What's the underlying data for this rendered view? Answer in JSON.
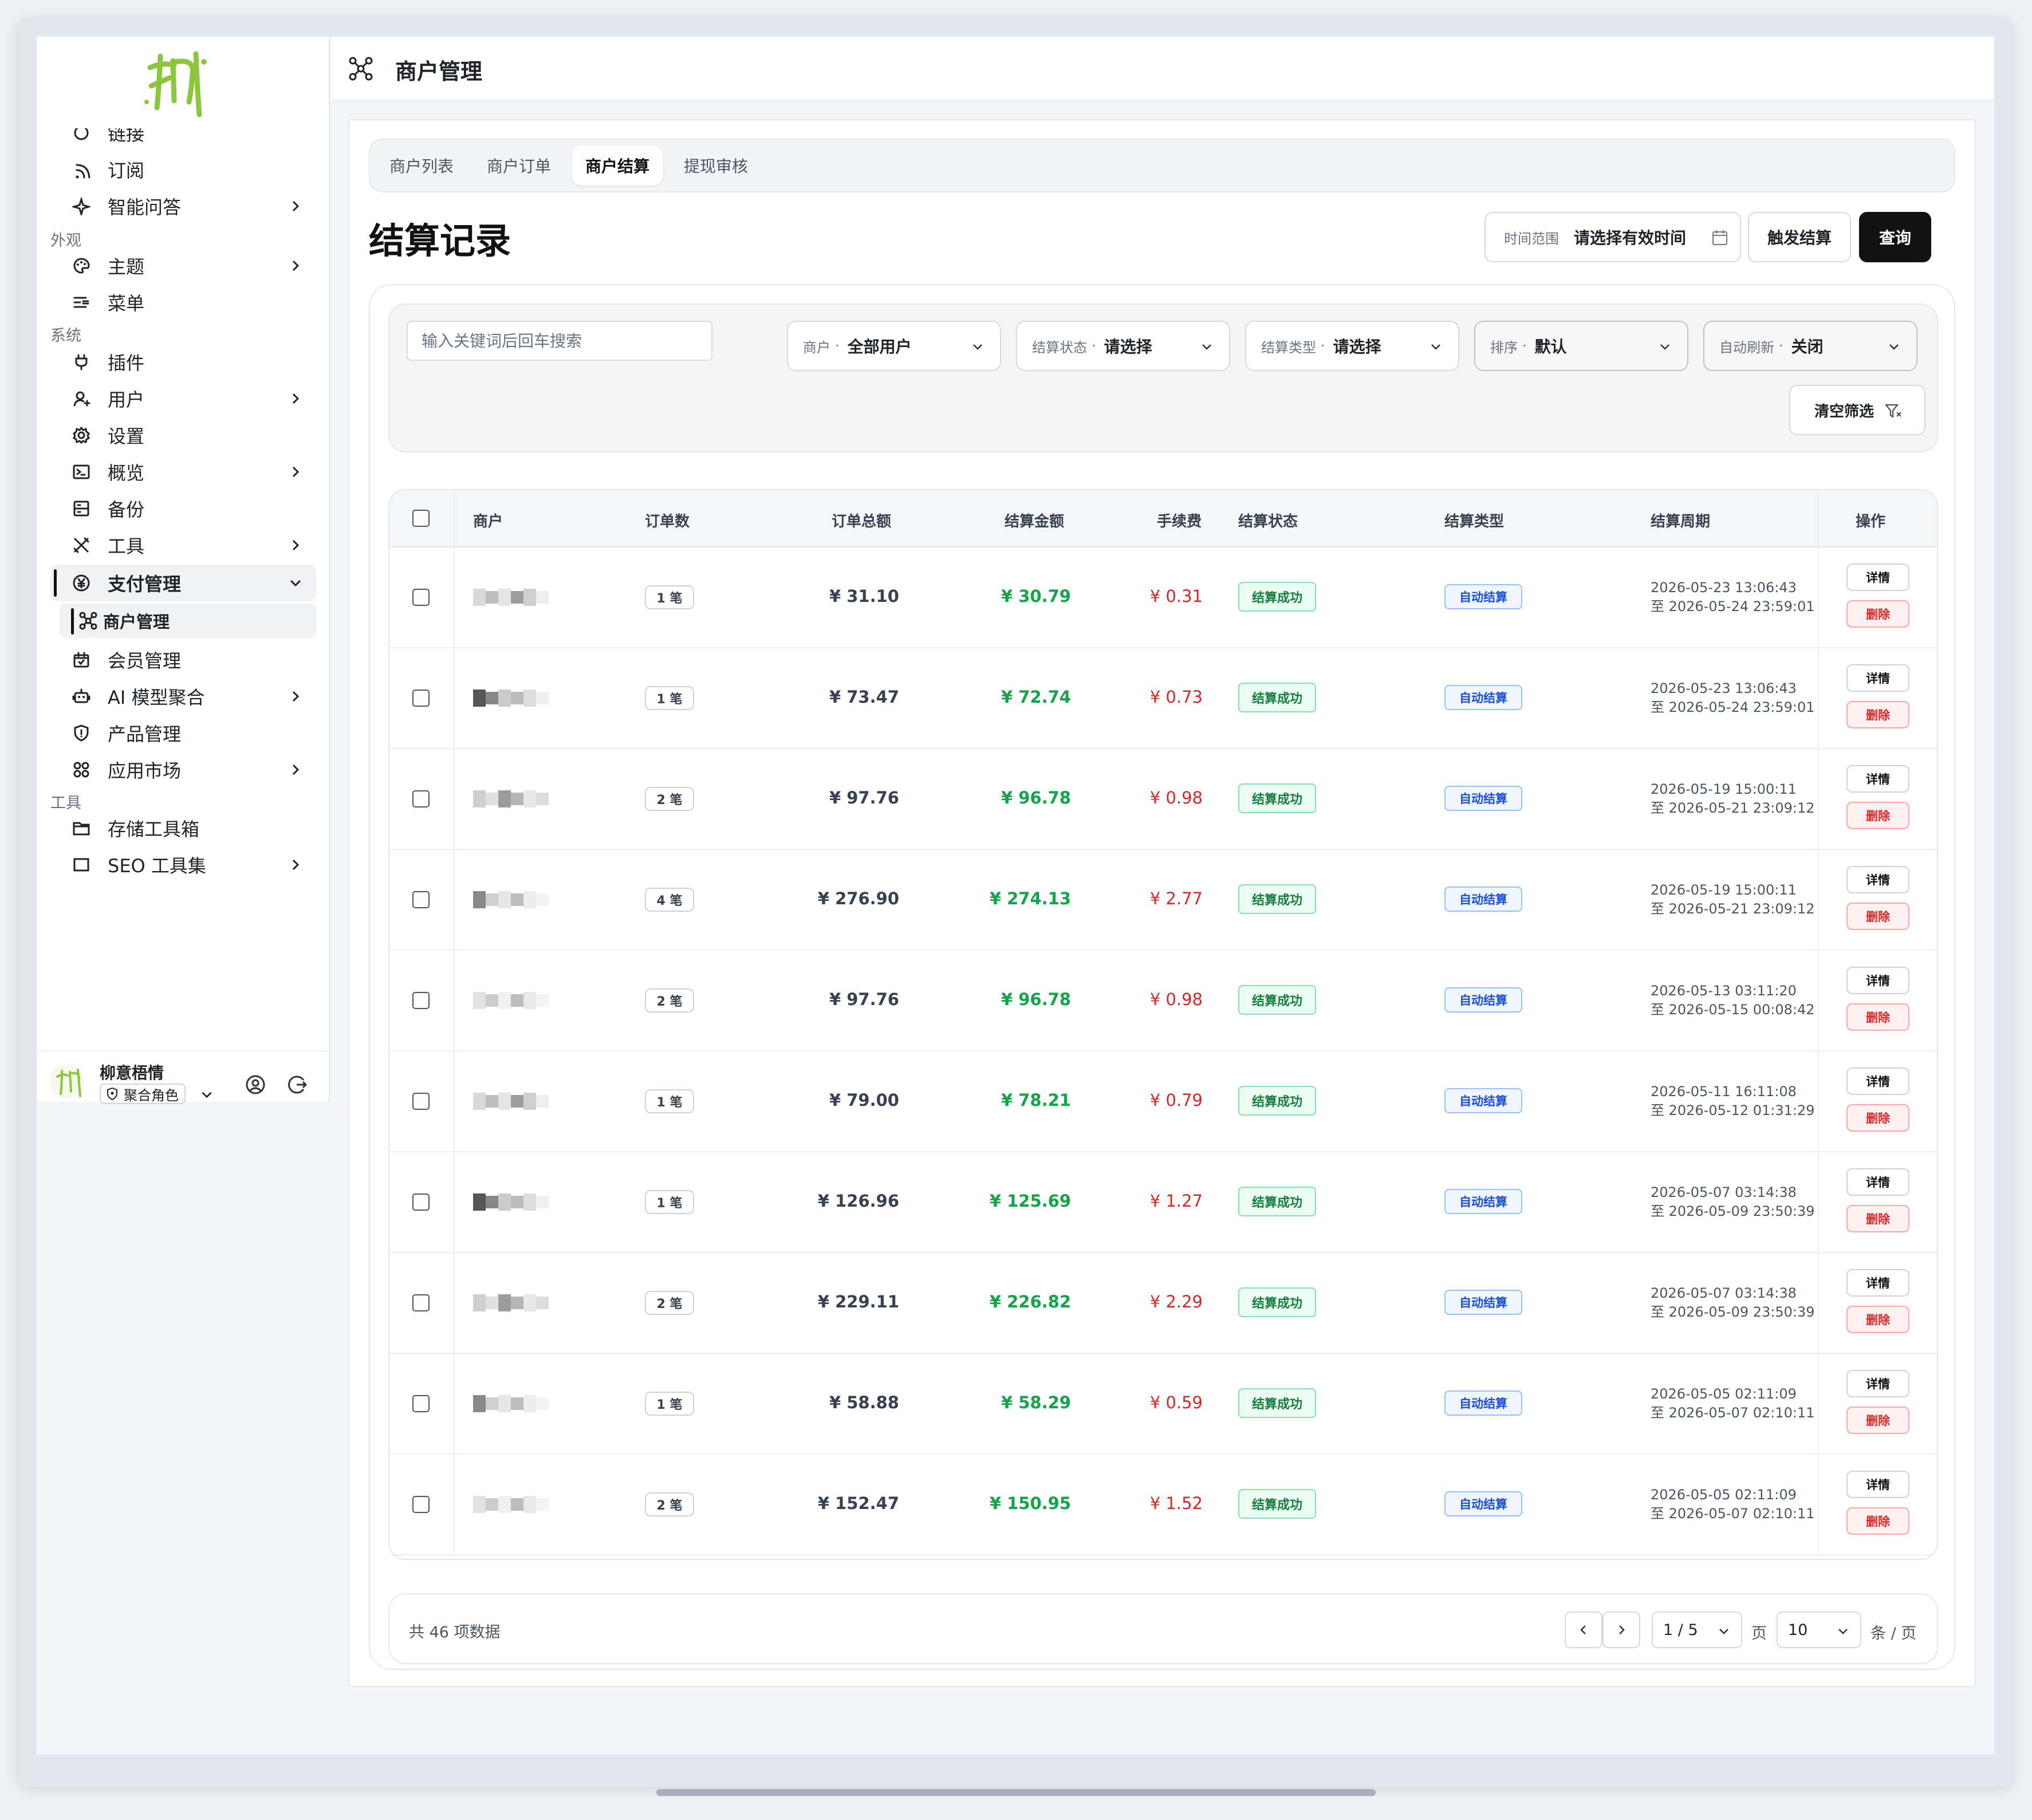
{
  "app": {
    "header_title": "商户管理",
    "user_name": "柳意梧情",
    "user_role": "聚合角色",
    "brand_color": "#8cc63f"
  },
  "sidebar": {
    "partial_top_label": "链接",
    "items": [
      {
        "label": "订阅",
        "icon": "rss-icon",
        "has_chevron": false
      },
      {
        "label": "智能问答",
        "icon": "sparkle-icon",
        "has_chevron": true
      },
      {
        "group": "外观"
      },
      {
        "label": "主题",
        "icon": "palette-icon",
        "has_chevron": true
      },
      {
        "label": "菜单",
        "icon": "menu-list-icon",
        "has_chevron": false
      },
      {
        "group": "系统"
      },
      {
        "label": "插件",
        "icon": "plug-icon",
        "has_chevron": false
      },
      {
        "label": "用户",
        "icon": "user-icon",
        "has_chevron": true
      },
      {
        "label": "设置",
        "icon": "gear-icon",
        "has_chevron": false
      },
      {
        "label": "概览",
        "icon": "terminal-icon",
        "has_chevron": true
      },
      {
        "label": "备份",
        "icon": "backup-icon",
        "has_chevron": false
      },
      {
        "label": "工具",
        "icon": "tools-icon",
        "has_chevron": true
      },
      {
        "label": "支付管理",
        "icon": "yen-circle-icon",
        "has_chevron": true,
        "expanded": true
      },
      {
        "label": "商户管理",
        "icon": "merchant-network-icon",
        "sub": true
      },
      {
        "label": "会员管理",
        "icon": "member-card-icon",
        "has_chevron": false
      },
      {
        "label": "AI 模型聚合",
        "icon": "robot-icon",
        "has_chevron": true
      },
      {
        "label": "产品管理",
        "icon": "shield-icon",
        "has_chevron": false
      },
      {
        "label": "应用市场",
        "icon": "apps-grid-icon",
        "has_chevron": true
      },
      {
        "group": "工具"
      },
      {
        "label": "存储工具箱",
        "icon": "folder-icon",
        "has_chevron": false
      }
    ],
    "partial_bottom_label": "SEO 工具集"
  },
  "tabs": [
    {
      "label": "商户列表",
      "active": false
    },
    {
      "label": "商户订单",
      "active": false
    },
    {
      "label": "商户结算",
      "active": true
    },
    {
      "label": "提现审核",
      "active": false
    }
  ],
  "page": {
    "title": "结算记录",
    "time_range_label": "时间范围",
    "time_range_value": "请选择有效时间",
    "trigger_button": "触发结算",
    "query_button": "查询"
  },
  "filters": {
    "search_placeholder": "输入关键词后回车搜索",
    "selects": [
      {
        "label": "商户",
        "value": "全部用户"
      },
      {
        "label": "结算状态",
        "value": "请选择"
      },
      {
        "label": "结算类型",
        "value": "请选择"
      },
      {
        "label": "排序",
        "value": "默认"
      },
      {
        "label": "自动刷新",
        "value": "关闭"
      }
    ],
    "clear_button": "清空筛选"
  },
  "table": {
    "columns": [
      "商户",
      "订单数",
      "订单总额",
      "结算金额",
      "手续费",
      "结算状态",
      "结算类型",
      "结算周期",
      "操作"
    ],
    "detail_label": "详情",
    "delete_label": "删除",
    "rows": [
      {
        "orders": "1 笔",
        "total": "¥ 31.10",
        "settle": "¥ 30.79",
        "fee": "¥ 0.31",
        "status": "结算成功",
        "type": "自动结算",
        "start": "2026-05-23 13:06:43",
        "end": "至 2026-05-24 23:59:01"
      },
      {
        "orders": "1 笔",
        "total": "¥ 73.47",
        "settle": "¥ 72.74",
        "fee": "¥ 0.73",
        "status": "结算成功",
        "type": "自动结算",
        "start": "2026-05-23 13:06:43",
        "end": "至 2026-05-24 23:59:01"
      },
      {
        "orders": "2 笔",
        "total": "¥ 97.76",
        "settle": "¥ 96.78",
        "fee": "¥ 0.98",
        "status": "结算成功",
        "type": "自动结算",
        "start": "2026-05-19 15:00:11",
        "end": "至 2026-05-21 23:09:12"
      },
      {
        "orders": "4 笔",
        "total": "¥ 276.90",
        "settle": "¥ 274.13",
        "fee": "¥ 2.77",
        "status": "结算成功",
        "type": "自动结算",
        "start": "2026-05-19 15:00:11",
        "end": "至 2026-05-21 23:09:12"
      },
      {
        "orders": "2 笔",
        "total": "¥ 97.76",
        "settle": "¥ 96.78",
        "fee": "¥ 0.98",
        "status": "结算成功",
        "type": "自动结算",
        "start": "2026-05-13 03:11:20",
        "end": "至 2026-05-15 00:08:42"
      },
      {
        "orders": "1 笔",
        "total": "¥ 79.00",
        "settle": "¥ 78.21",
        "fee": "¥ 0.79",
        "status": "结算成功",
        "type": "自动结算",
        "start": "2026-05-11 16:11:08",
        "end": "至 2026-05-12 01:31:29"
      },
      {
        "orders": "1 笔",
        "total": "¥ 126.96",
        "settle": "¥ 125.69",
        "fee": "¥ 1.27",
        "status": "结算成功",
        "type": "自动结算",
        "start": "2026-05-07 03:14:38",
        "end": "至 2026-05-09 23:50:39"
      },
      {
        "orders": "2 笔",
        "total": "¥ 229.11",
        "settle": "¥ 226.82",
        "fee": "¥ 2.29",
        "status": "结算成功",
        "type": "自动结算",
        "start": "2026-05-07 03:14:38",
        "end": "至 2026-05-09 23:50:39"
      },
      {
        "orders": "1 笔",
        "total": "¥ 58.88",
        "settle": "¥ 58.29",
        "fee": "¥ 0.59",
        "status": "结算成功",
        "type": "自动结算",
        "start": "2026-05-05 02:11:09",
        "end": "至 2026-05-07 02:10:11"
      },
      {
        "orders": "2 笔",
        "total": "¥ 152.47",
        "settle": "¥ 150.95",
        "fee": "¥ 1.52",
        "status": "结算成功",
        "type": "自动结算",
        "start": "2026-05-05 02:11:09",
        "end": "至 2026-05-07 02:10:11"
      }
    ]
  },
  "pagination": {
    "total_text": "共 46 项数据",
    "page_value": "1 / 5",
    "page_unit": "页",
    "page_size": "10",
    "size_unit": "条 / 页"
  }
}
